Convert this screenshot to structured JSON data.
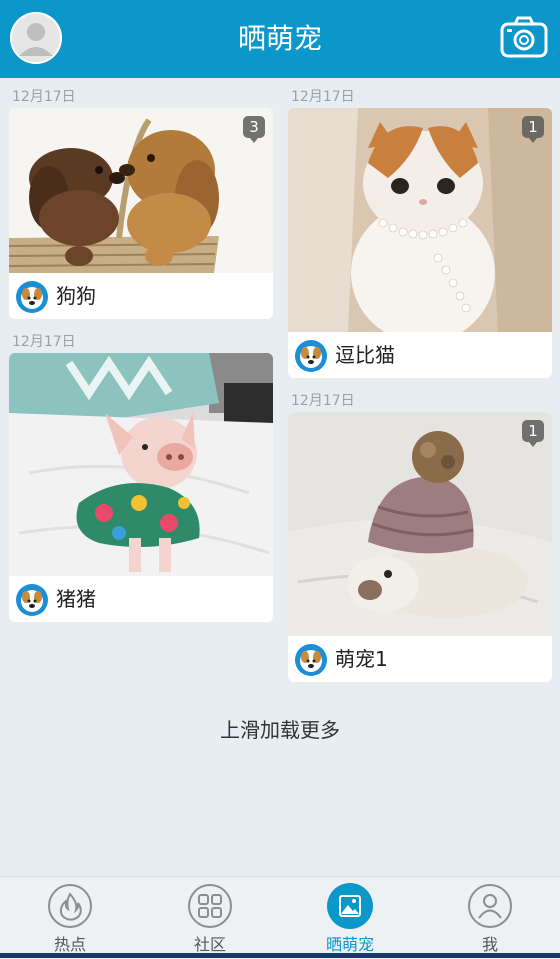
{
  "header": {
    "title": "晒萌宠",
    "avatar_icon": "user-avatar-icon",
    "camera_icon": "camera-icon"
  },
  "feed": {
    "left": [
      {
        "date": "12月17日",
        "name": "狗狗",
        "comments": "3",
        "image": "two puppies in a basket"
      },
      {
        "date": "12月17日",
        "name": "猪猪",
        "image": "piglet wearing a floral shirt"
      }
    ],
    "right": [
      {
        "date": "12月17日",
        "name": "逗比猫",
        "comments": "1",
        "image": "cat with pearl necklace"
      },
      {
        "date": "12月17日",
        "name": "萌宠1",
        "comments": "1",
        "image": "rabbit wearing a knit hat"
      }
    ]
  },
  "load_more": "上滑加载更多",
  "tabs": [
    {
      "label": "热点",
      "icon": "flame-icon"
    },
    {
      "label": "社区",
      "icon": "grid-icon"
    },
    {
      "label": "晒萌宠",
      "icon": "picture-icon"
    },
    {
      "label": "我",
      "icon": "user-icon"
    }
  ],
  "colors": {
    "primary": "#0b97c9",
    "background": "#e8edf2"
  }
}
